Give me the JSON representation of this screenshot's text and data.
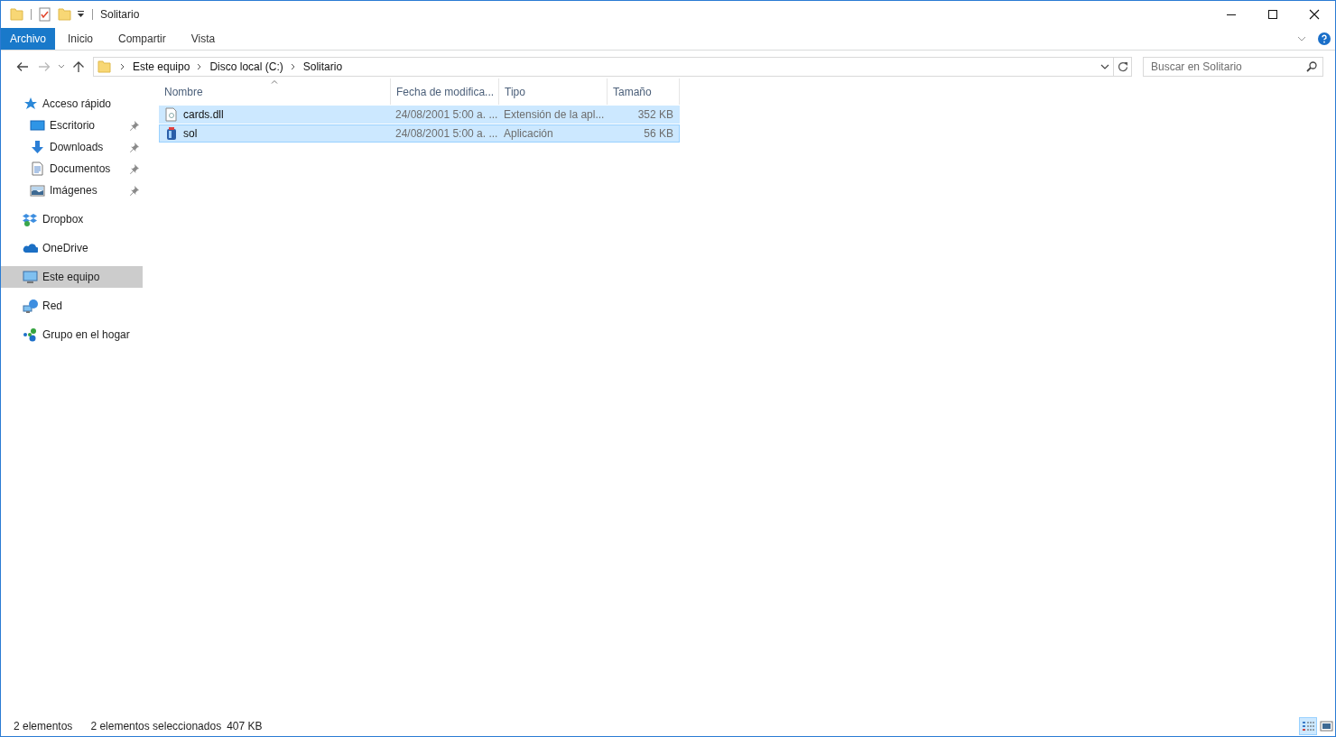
{
  "window": {
    "title": "Solitario"
  },
  "ribbon": {
    "tabs": [
      {
        "label": "Archivo",
        "kind": "file",
        "selected": false
      },
      {
        "label": "Inicio",
        "kind": "tab",
        "selected": false
      },
      {
        "label": "Compartir",
        "kind": "tab",
        "selected": false
      },
      {
        "label": "Vista",
        "kind": "tab",
        "selected": false
      }
    ]
  },
  "address": {
    "path": [
      "Este equipo",
      "Disco local (C:)",
      "Solitario"
    ]
  },
  "search": {
    "placeholder": "Buscar en Solitario"
  },
  "sidebar": {
    "items": [
      {
        "label": "Acceso rápido",
        "selected": false,
        "children": [
          {
            "label": "Escritorio",
            "pinned": true,
            "selected": false
          },
          {
            "label": "Downloads",
            "pinned": true,
            "selected": false
          },
          {
            "label": "Documentos",
            "pinned": true,
            "selected": false
          },
          {
            "label": "Imágenes",
            "pinned": true,
            "selected": false
          }
        ]
      },
      {
        "label": "Dropbox",
        "selected": false
      },
      {
        "label": "OneDrive",
        "selected": false
      },
      {
        "label": "Este equipo",
        "selected": true
      },
      {
        "label": "Red",
        "selected": false
      },
      {
        "label": "Grupo en el hogar",
        "selected": false
      }
    ]
  },
  "table": {
    "columns": [
      {
        "label": "Nombre",
        "sorted": true
      },
      {
        "label": "Fecha de modifica...",
        "sorted": false
      },
      {
        "label": "Tipo",
        "sorted": false
      },
      {
        "label": "Tamaño",
        "sorted": false
      }
    ],
    "rows": [
      {
        "name": "cards.dll",
        "date": "24/08/2001 5:00 a. ...",
        "type": "Extensión de la apl...",
        "size": "352 KB",
        "selected": true
      },
      {
        "name": "sol",
        "date": "24/08/2001 5:00 a. ...",
        "type": "Aplicación",
        "size": "56 KB",
        "selected": true
      }
    ]
  },
  "status_bar": {
    "count": "2 elementos",
    "selection": "2 elementos seleccionados",
    "size": "407 KB",
    "views": [
      {
        "selected": true
      },
      {
        "selected": false
      }
    ]
  }
}
